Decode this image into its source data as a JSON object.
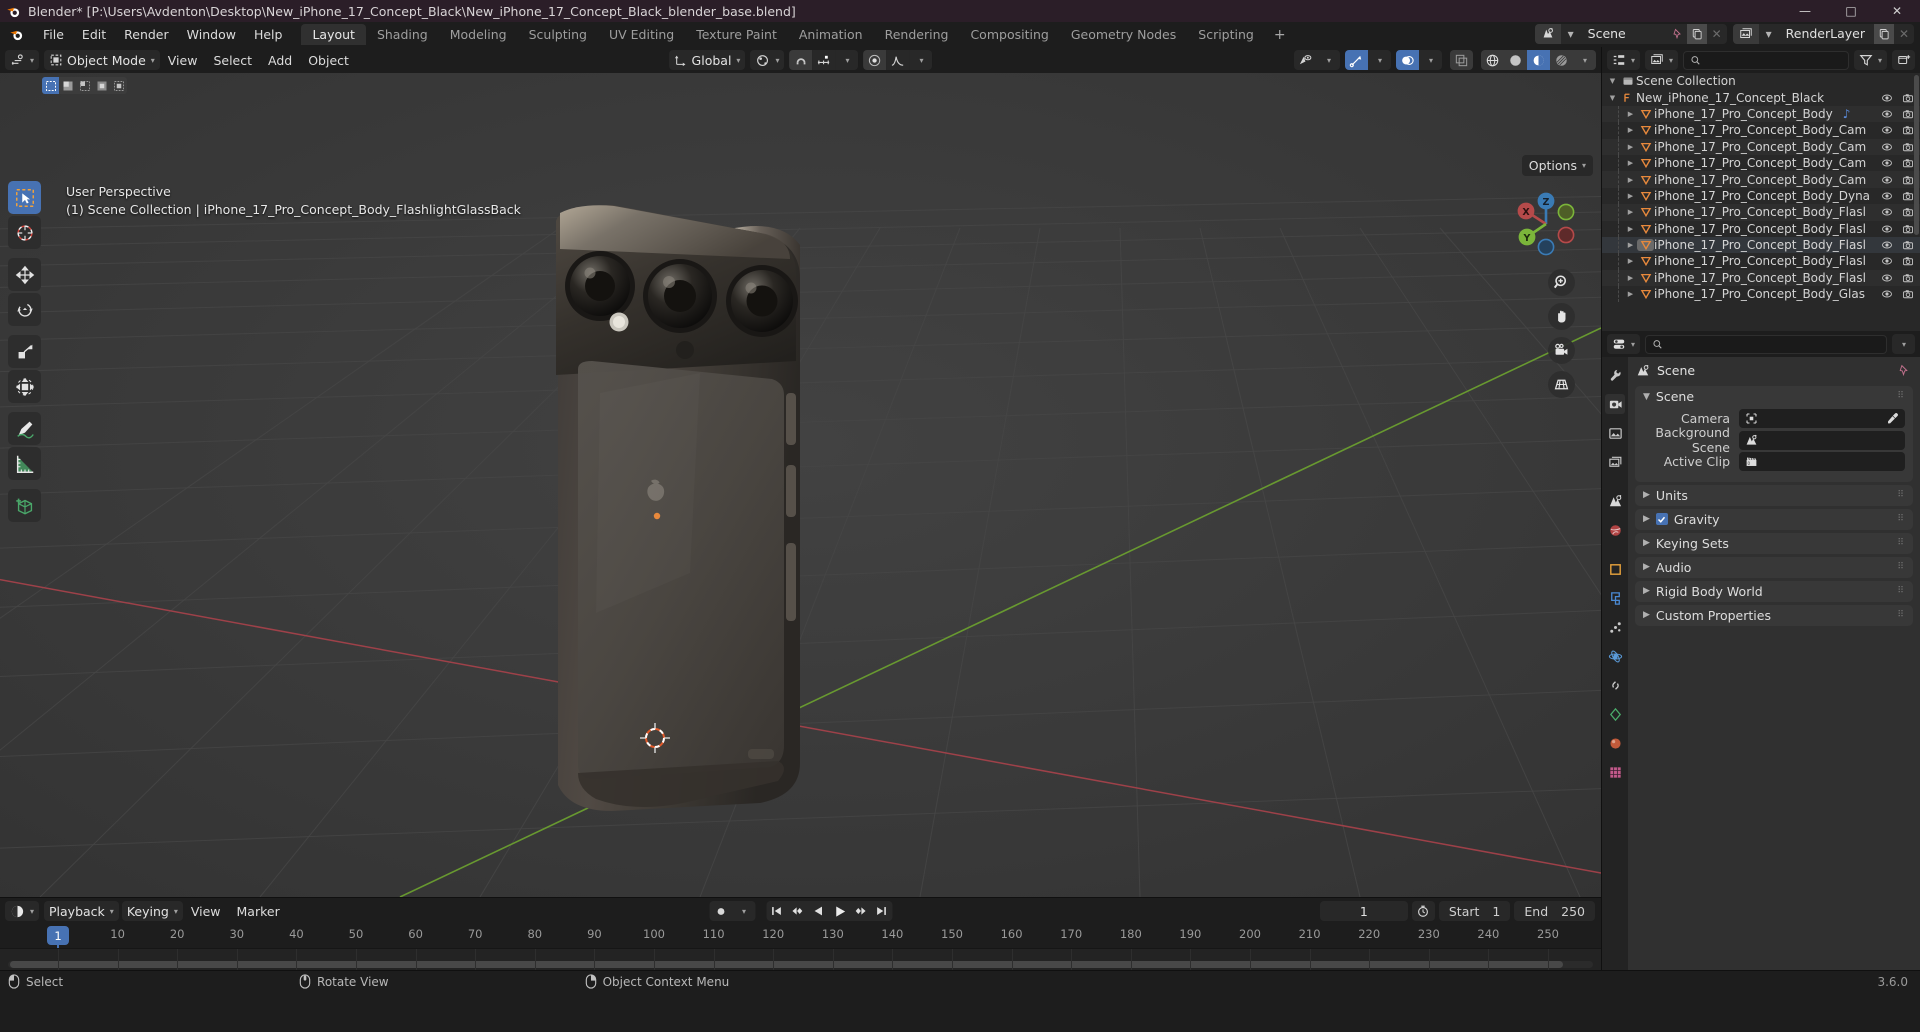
{
  "titlebar": {
    "text": "Blender* [P:\\Users\\Avdenton\\Desktop\\New_iPhone_17_Concept_Black\\New_iPhone_17_Concept_Black_blender_base.blend]",
    "minimize": "—",
    "maximize": "□",
    "close": "✕"
  },
  "menubar": {
    "items": [
      "File",
      "Edit",
      "Render",
      "Window",
      "Help"
    ],
    "workspaces": [
      {
        "label": "Layout",
        "active": true
      },
      {
        "label": "Shading",
        "active": false
      },
      {
        "label": "Modeling",
        "active": false
      },
      {
        "label": "Sculpting",
        "active": false
      },
      {
        "label": "UV Editing",
        "active": false
      },
      {
        "label": "Texture Paint",
        "active": false
      },
      {
        "label": "Animation",
        "active": false
      },
      {
        "label": "Rendering",
        "active": false
      },
      {
        "label": "Compositing",
        "active": false
      },
      {
        "label": "Geometry Nodes",
        "active": false
      },
      {
        "label": "Scripting",
        "active": false
      }
    ],
    "add_workspace": "+",
    "scene_name": "Scene",
    "viewlayer_name": "RenderLayer"
  },
  "viewport_header": {
    "mode": "Object Mode",
    "menus": [
      "View",
      "Select",
      "Add",
      "Object"
    ],
    "transform_orientation": "Global",
    "options_label": "Options"
  },
  "viewport": {
    "perspective_label": "User Perspective",
    "object_path": "(1) Scene Collection | iPhone_17_Pro_Concept_Body_FlashlightGlassBack",
    "gizmo_axes": [
      "X",
      "Y",
      "Z"
    ],
    "tools": [
      "tweak-select-tool",
      "cursor-tool",
      "move-tool",
      "rotate-tool",
      "scale-tool",
      "transform-tool",
      "annotate-tool",
      "measure-tool",
      "add-cube-tool"
    ],
    "nav_buttons": [
      "zoom-icon",
      "hand-icon",
      "camera-icon",
      "grid-ortho-icon"
    ]
  },
  "outliner": {
    "scene_collection": "Scene Collection",
    "rows": [
      {
        "label": "New_iPhone_17_Concept_Black",
        "depth": 0,
        "icon": "collection-icon",
        "open": true,
        "selected": false
      },
      {
        "label": "iPhone_17_Pro_Concept_Body",
        "depth": 1,
        "icon": "mesh-icon",
        "open": false,
        "selected": false,
        "anim": true
      },
      {
        "label": "iPhone_17_Pro_Concept_Body_Cam",
        "depth": 1,
        "icon": "mesh-icon",
        "open": false,
        "selected": false
      },
      {
        "label": "iPhone_17_Pro_Concept_Body_Cam",
        "depth": 1,
        "icon": "mesh-icon",
        "open": false,
        "selected": false
      },
      {
        "label": "iPhone_17_Pro_Concept_Body_Cam",
        "depth": 1,
        "icon": "mesh-icon",
        "open": false,
        "selected": false
      },
      {
        "label": "iPhone_17_Pro_Concept_Body_Cam",
        "depth": 1,
        "icon": "mesh-icon",
        "open": false,
        "selected": false
      },
      {
        "label": "iPhone_17_Pro_Concept_Body_Dyna",
        "depth": 1,
        "icon": "mesh-icon",
        "open": false,
        "selected": false
      },
      {
        "label": "iPhone_17_Pro_Concept_Body_Flasl",
        "depth": 1,
        "icon": "mesh-icon",
        "open": false,
        "selected": false
      },
      {
        "label": "iPhone_17_Pro_Concept_Body_Flasl",
        "depth": 1,
        "icon": "mesh-icon",
        "open": false,
        "selected": false
      },
      {
        "label": "iPhone_17_Pro_Concept_Body_Flasl",
        "depth": 1,
        "icon": "mesh-icon",
        "open": false,
        "selected": true
      },
      {
        "label": "iPhone_17_Pro_Concept_Body_Flasl",
        "depth": 1,
        "icon": "mesh-icon",
        "open": false,
        "selected": false
      },
      {
        "label": "iPhone_17_Pro_Concept_Body_Flasl",
        "depth": 1,
        "icon": "mesh-icon",
        "open": false,
        "selected": false
      },
      {
        "label": "iPhone_17_Pro_Concept_Body_Glas",
        "depth": 1,
        "icon": "mesh-icon",
        "open": false,
        "selected": false
      }
    ]
  },
  "properties": {
    "breadcrumb": "Scene",
    "panels": [
      {
        "label": "Scene",
        "open": true,
        "checkbox": false
      },
      {
        "label": "Units",
        "open": false,
        "checkbox": false
      },
      {
        "label": "Gravity",
        "open": false,
        "checkbox": true
      },
      {
        "label": "Keying Sets",
        "open": false,
        "checkbox": false
      },
      {
        "label": "Audio",
        "open": false,
        "checkbox": false
      },
      {
        "label": "Rigid Body World",
        "open": false,
        "checkbox": false
      },
      {
        "label": "Custom Properties",
        "open": false,
        "checkbox": false
      }
    ],
    "scene_fields": [
      {
        "label": "Camera",
        "value": "",
        "icon": "camera-data-icon",
        "eyedropper": true
      },
      {
        "label": "Background Scene",
        "value": "",
        "icon": "scene-icon",
        "eyedropper": false
      },
      {
        "label": "Active Clip",
        "value": "",
        "icon": "clip-icon",
        "eyedropper": false
      }
    ]
  },
  "timeline": {
    "menus": [
      "Playback",
      "Keying",
      "View",
      "Marker"
    ],
    "current_frame": "1",
    "start_label": "Start",
    "start_value": "1",
    "end_label": "End",
    "end_value": "250",
    "ticks": [
      "1",
      "10",
      "20",
      "30",
      "40",
      "50",
      "60",
      "70",
      "80",
      "90",
      "100",
      "110",
      "120",
      "130",
      "140",
      "150",
      "160",
      "170",
      "180",
      "190",
      "200",
      "210",
      "220",
      "230",
      "240",
      "250"
    ],
    "playhead_frame": "1"
  },
  "statusbar": {
    "items": [
      {
        "icon": "mouse-left-icon",
        "label": "Select"
      },
      {
        "icon": "mouse-middle-icon",
        "label": "Rotate View"
      },
      {
        "icon": "mouse-right-icon",
        "label": "Object Context Menu"
      }
    ],
    "version": "3.6.0"
  },
  "colors": {
    "accent": "#4772b3",
    "orange": "#e8893c",
    "axis_x": "#b54a4a",
    "axis_y": "#7bb53a",
    "axis_z": "#3a7bb5"
  }
}
